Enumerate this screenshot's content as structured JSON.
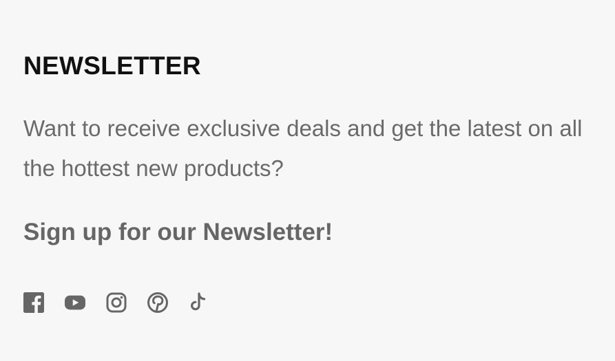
{
  "newsletter": {
    "title": "NEWSLETTER",
    "description": "Want to receive exclusive deals and get the latest on all the hottest new products?",
    "cta": "Sign up for our Newsletter!"
  },
  "social": {
    "icons": [
      "facebook-icon",
      "youtube-icon",
      "instagram-icon",
      "pinterest-icon",
      "tiktok-icon"
    ],
    "icon_color": "#666666"
  },
  "colors": {
    "background": "#f7f7f7",
    "title": "#111111",
    "text": "#6a6a6a"
  }
}
